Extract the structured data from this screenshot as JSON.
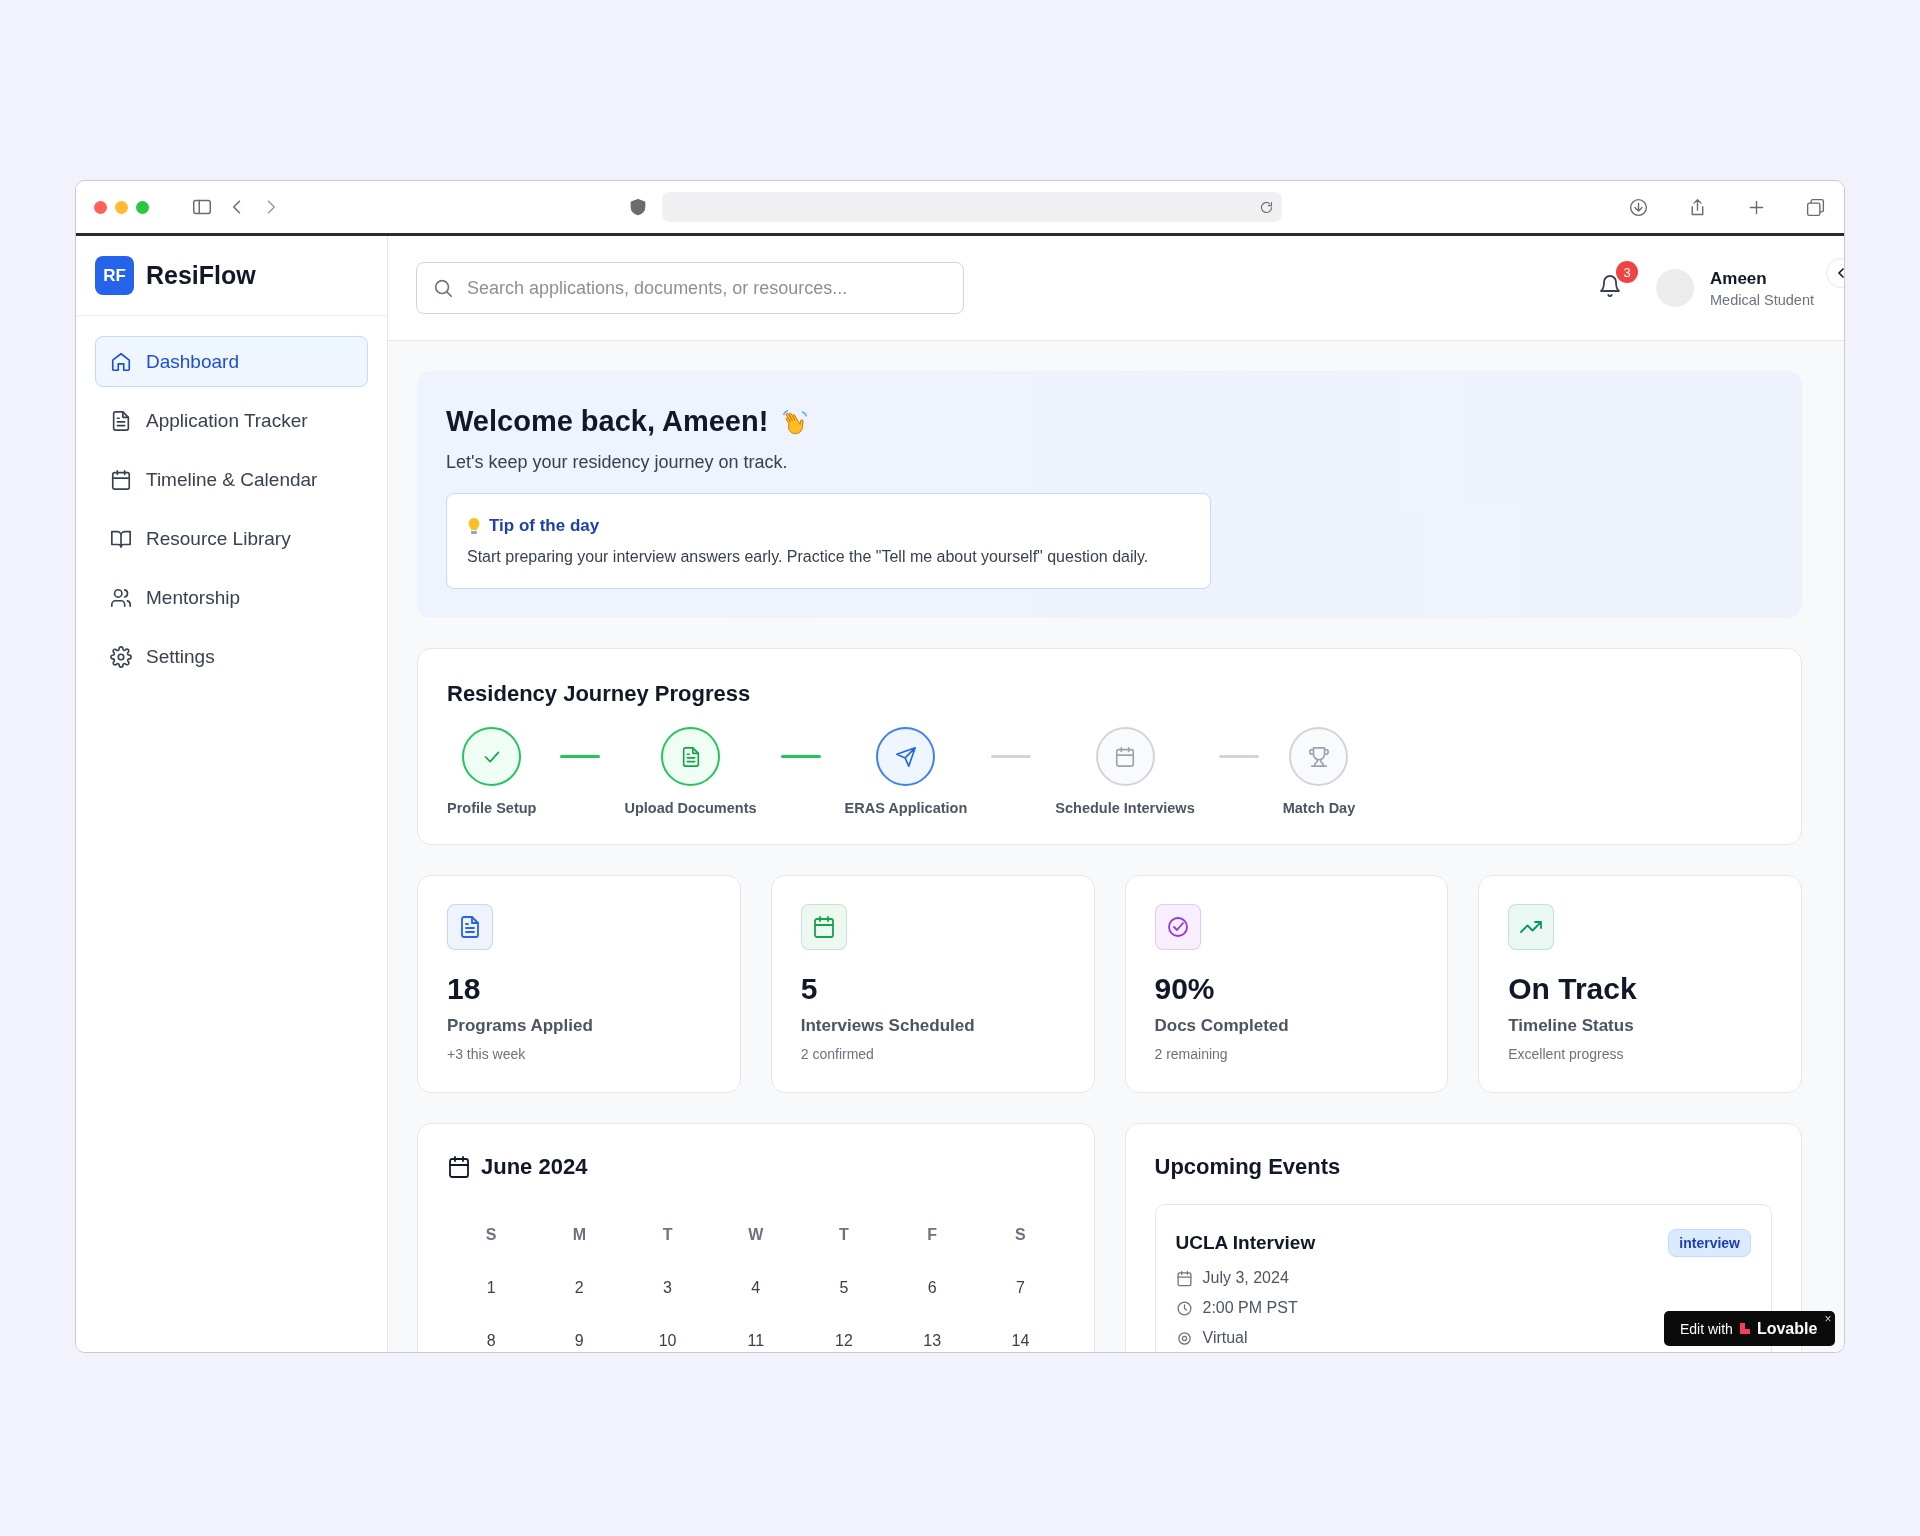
{
  "app": {
    "logo_mark": "RF",
    "name": "ResiFlow"
  },
  "sidebar": {
    "items": [
      {
        "label": "Dashboard",
        "selected": true
      },
      {
        "label": "Application Tracker",
        "selected": false
      },
      {
        "label": "Timeline & Calendar",
        "selected": false
      },
      {
        "label": "Resource Library",
        "selected": false
      },
      {
        "label": "Mentorship",
        "selected": false
      },
      {
        "label": "Settings",
        "selected": false
      }
    ]
  },
  "header": {
    "search": {
      "placeholder": "Search applications, documents, or resources..."
    },
    "notifications": {
      "count": "3"
    },
    "user": {
      "name": "Ameen",
      "role": "Medical Student"
    }
  },
  "welcome": {
    "title": "Welcome back, Ameen!",
    "subtitle": "Let's keep your residency journey on track.",
    "tip": {
      "title": "Tip of the day",
      "text": "Start preparing your interview answers early. Practice the \"Tell me about yourself\" question daily."
    }
  },
  "progress": {
    "title": "Residency Journey Progress",
    "steps": [
      {
        "label": "Profile Setup",
        "kind": "done"
      },
      {
        "label": "Upload Documents",
        "kind": "done"
      },
      {
        "label": "ERAS Application",
        "kind": "active"
      },
      {
        "label": "Schedule Interviews",
        "kind": "pending"
      },
      {
        "label": "Match Day",
        "kind": "pending"
      }
    ]
  },
  "stats": [
    {
      "value": "18",
      "label": "Programs Applied",
      "note": "+3 this week",
      "color": "#2563eb"
    },
    {
      "value": "5",
      "label": "Interviews Scheduled",
      "note": "2 confirmed",
      "color": "#16a34a"
    },
    {
      "value": "90%",
      "label": "Docs Completed",
      "note": "2 remaining",
      "color": "#9333ea"
    },
    {
      "value": "On Track",
      "label": "Timeline Status",
      "note": "Excellent progress",
      "color": "#059669"
    }
  ],
  "calendar": {
    "title": "June 2024",
    "weekdays": [
      "S",
      "M",
      "T",
      "W",
      "T",
      "F",
      "S"
    ],
    "weeks": [
      [
        "1",
        "2",
        "3",
        "4",
        "5",
        "6",
        "7"
      ],
      [
        "8",
        "9",
        "10",
        "11",
        "12",
        "13",
        "14"
      ]
    ]
  },
  "events": {
    "title": "Upcoming Events",
    "items": [
      {
        "name": "UCLA Interview",
        "tag": "interview",
        "date": "July 3, 2024",
        "time": "2:00 PM PST",
        "location": "Virtual"
      }
    ]
  },
  "badge": {
    "prefix": "Edit with",
    "brand": "Lovable",
    "close": "×"
  }
}
